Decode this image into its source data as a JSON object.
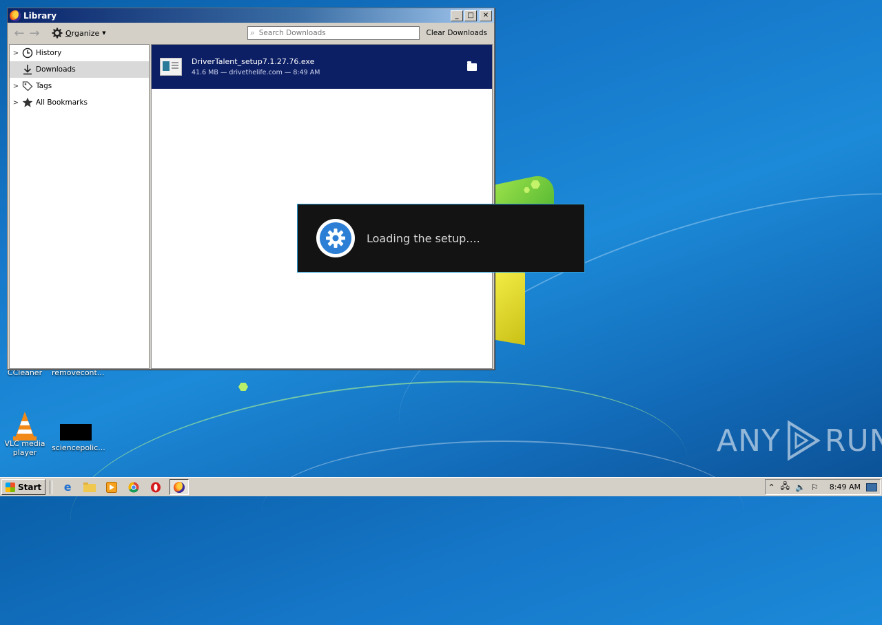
{
  "window": {
    "title": "Library",
    "organize_label": "Organize",
    "search_placeholder": "Search Downloads",
    "clear_label": "Clear Downloads",
    "minimize_glyph": "_",
    "maximize_glyph": "□",
    "close_glyph": "✕"
  },
  "sidebar": {
    "items": [
      {
        "label": "History",
        "icon": "clock-icon",
        "expandable": true
      },
      {
        "label": "Downloads",
        "icon": "download-icon",
        "expandable": false,
        "selected": true
      },
      {
        "label": "Tags",
        "icon": "tag-icon",
        "expandable": true
      },
      {
        "label": "All Bookmarks",
        "icon": "star-icon",
        "expandable": true
      }
    ]
  },
  "downloads": [
    {
      "name": "DriverTalent_setup7.1.27.76.exe",
      "meta": "41.6 MB — drivethelife.com — 8:49 AM"
    }
  ],
  "loading": {
    "text": "Loading the setup...."
  },
  "desktop_icons": [
    {
      "label": "CCleaner"
    },
    {
      "label": "removecont..."
    },
    {
      "label_line1": "VLC media",
      "label_line2": "player"
    },
    {
      "label": "sciencepolic..."
    }
  ],
  "watermark": {
    "left": "ANY",
    "right": "RUN"
  },
  "taskbar": {
    "start_label": "Start",
    "clock": "8:49 AM"
  }
}
